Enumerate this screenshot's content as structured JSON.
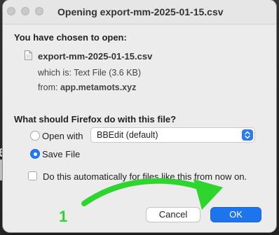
{
  "window": {
    "title": "Opening export-mm-2025-01-15.csv"
  },
  "content": {
    "chosen_heading": "You have chosen to open:",
    "file_name": "export-mm-2025-01-15.csv",
    "which_is_label": "which is:",
    "which_is_value": "Text File (3.6 KB)",
    "from_label": "from:",
    "from_value": "app.metamots.xyz"
  },
  "action": {
    "heading": "What should Firefox do with this file?",
    "open_with_label": "Open with",
    "open_with_app": "BBEdit (default)",
    "open_with_selected": false,
    "save_file_label": "Save File",
    "save_file_selected": true,
    "auto_label": "Do this automatically for files like this from now on.",
    "auto_checked": false
  },
  "buttons": {
    "cancel": "Cancel",
    "ok": "OK"
  },
  "annotation": {
    "step_number": "1",
    "color": "#2ed52e"
  },
  "background": {
    "visible_letter": "e"
  },
  "colors": {
    "accent": "#1e74ed",
    "dialog_bg": "#ececec"
  },
  "icons": {
    "file": "file-icon",
    "select_arrows": "chevron-updown-icon",
    "annotation_arrow": "arrow-icon"
  }
}
